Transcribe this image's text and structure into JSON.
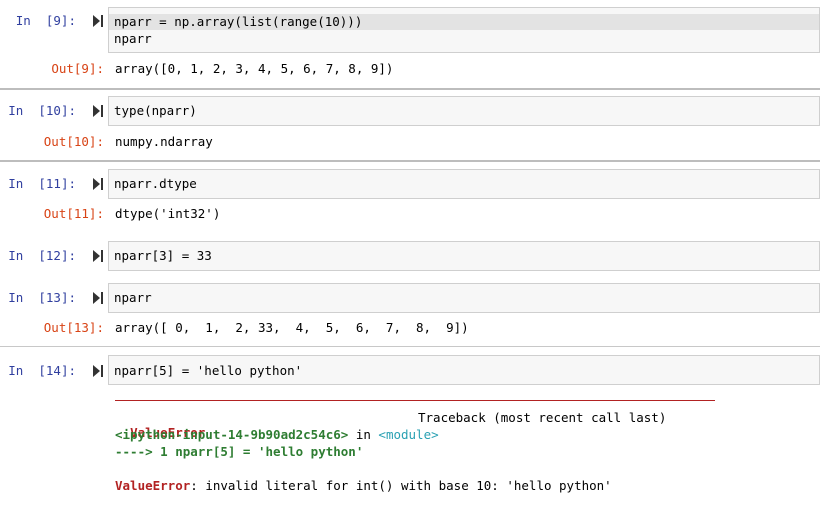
{
  "cells": [
    {
      "prompt_in": "In  [9]:",
      "code": [
        "nparr = np.array(list(range(10)))",
        "nparr"
      ],
      "prompt_out": "Out[9]:",
      "output": "array([0, 1, 2, 3, 4, 5, 6, 7, 8, 9])"
    },
    {
      "prompt_in": "In  [10]:",
      "code": [
        "type(nparr)"
      ],
      "prompt_out": "Out[10]:",
      "output": "numpy.ndarray"
    },
    {
      "prompt_in": "In  [11]:",
      "code": [
        "nparr.dtype"
      ],
      "prompt_out": "Out[11]:",
      "output": "dtype('int32')"
    },
    {
      "prompt_in": "In  [12]:",
      "code": [
        "nparr[3] = 33"
      ]
    },
    {
      "prompt_in": "In  [13]:",
      "code": [
        "nparr"
      ],
      "prompt_out": "Out[13]:",
      "output": "array([ 0,  1,  2, 33,  4,  5,  6,  7,  8,  9])"
    },
    {
      "prompt_in": "In  [14]:",
      "code": [
        "nparr[5] = 'hello python'"
      ]
    }
  ],
  "traceback": {
    "error_name": "ValueError",
    "traceback_label": "Traceback (most recent call last)",
    "input_ref": "<ipython-input-14-9b90ad2c54c6>",
    "in_word": "in",
    "module_ref": "<module>",
    "arrow_line": "----> 1 nparr[5] = 'hello python'",
    "message_error": "ValueError",
    "message_rest": ": invalid literal for int() with base 10: 'hello python'"
  },
  "colors": {
    "prompt_in": "#303f9f",
    "prompt_out": "#d84315",
    "error": "#b22222"
  }
}
